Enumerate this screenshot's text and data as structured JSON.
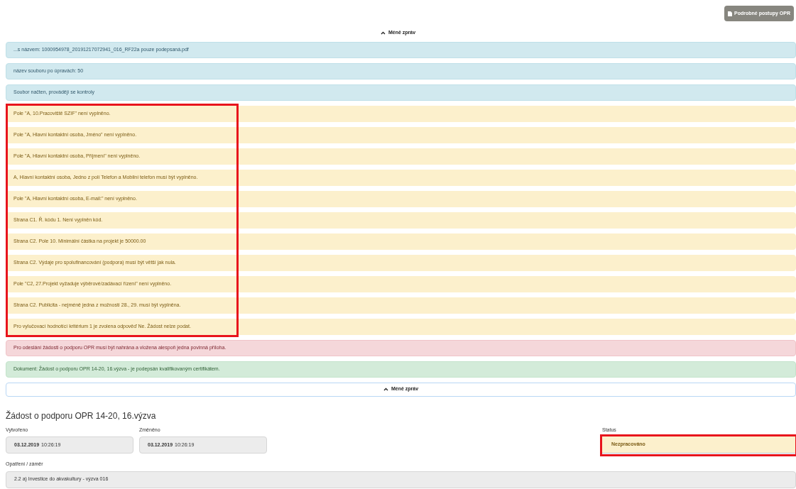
{
  "top_button": {
    "label": "Podrobné postupy OPR"
  },
  "toggle_top": {
    "label": "Méně zpráv"
  },
  "message_groups": [
    {
      "highlighted": false,
      "messages": [
        {
          "kind": "info",
          "text": "...s názvem: 1000954978_20191217072941_016_RF22a pouze podepsaná.pdf"
        },
        {
          "kind": "info",
          "text": "název souboru po úpravách: 50"
        },
        {
          "kind": "info",
          "text": "Soubor načten, provádějí se kontroly"
        }
      ]
    },
    {
      "highlighted": true,
      "messages": [
        {
          "kind": "warning",
          "text": "Pole \"A, 10.Pracoviště SZIF\" není vyplněno."
        },
        {
          "kind": "warning",
          "text": "Pole \"A, Hlavní kontaktní osoba, Jméno\" není vyplněno."
        },
        {
          "kind": "warning",
          "text": "Pole \"A, Hlavní kontaktní osoba, Příjmení\" není vyplněno."
        },
        {
          "kind": "warning",
          "text": "A, Hlavní kontaktní osoba, Jedno z polí Telefon a Mobilní telefon musí být vyplněno."
        },
        {
          "kind": "warning",
          "text": "Pole \"A, Hlavní kontaktní osoba, E-mail:\" není vyplněno."
        },
        {
          "kind": "warning",
          "text": "Strana C1. Ř. kódu 1. Není vyplněn kód."
        },
        {
          "kind": "warning",
          "text": "Strana C2. Pole 10. Minimální částka na projekt je 50000.00"
        },
        {
          "kind": "warning",
          "text": "Strana C2. Výdaje pro spolufinancování (podpora) musí být větší jak nula."
        },
        {
          "kind": "warning",
          "text": "Pole \"C2, 27.Projekt vyžaduje výběrové/zadávací řízení\" není vyplněno."
        },
        {
          "kind": "warning",
          "text": "Strana C2. Publicita - nejméně jedna z možností 28., 29. musí být vyplněna."
        },
        {
          "kind": "warning",
          "text": "Pro vylučovací hodnotící kritérium 1 je zvolena odpověď Ne. Žádost nelze podat."
        }
      ]
    },
    {
      "highlighted": false,
      "messages": [
        {
          "kind": "danger",
          "text": "Pro odeslání žádosti o podporu OPR musí být nahrána a vložena alespoň jedna povinná příloha."
        },
        {
          "kind": "success",
          "text": "Dokument: Žádost o podporu OPR 14-20, 16.výzva - je podepsán kvalifikovaným certifikátem."
        }
      ]
    }
  ],
  "toggle_bottom": {
    "label": "Méně zpráv"
  },
  "form": {
    "title": "Žádost o podporu OPR 14-20, 16.výzva",
    "created": {
      "label": "Vytvořeno",
      "date": "03.12.2019",
      "time": "10:26:19"
    },
    "changed": {
      "label": "Změněno",
      "date": "03.12.2019",
      "time": "10:26:19"
    },
    "status": {
      "label": "Status",
      "value": "Nezpracováno",
      "highlighted": true
    },
    "measure": {
      "label": "Opatření / záměr",
      "value": "2.2 a) Investice do akvakultury - výzva 016"
    }
  }
}
